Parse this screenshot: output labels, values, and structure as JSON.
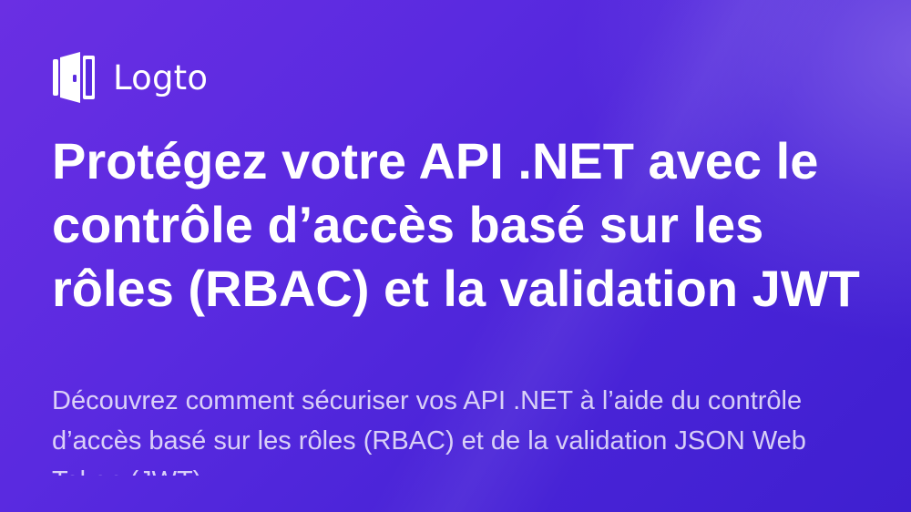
{
  "brand": {
    "name": "Logto",
    "icon": "logto-door-icon"
  },
  "article": {
    "title": "Protégez votre API .NET avec le contrôle d’accès basé sur les rôles (RBAC) et la validation JWT",
    "description": "Découvrez comment sécuriser vos API .NET à l’aide du contrôle d’accès basé sur les rôles (RBAC) et de la validation JSON Web Token (JWT)"
  },
  "colors": {
    "background_start": "#6a2fe3",
    "background_end": "#3f1fd0",
    "text": "#ffffff"
  }
}
